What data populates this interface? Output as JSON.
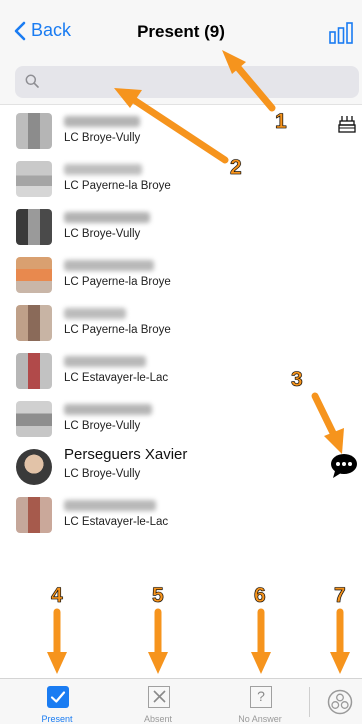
{
  "nav": {
    "back_label": "Back",
    "title": "Present (9)",
    "chart_icon": "bar-chart-icon"
  },
  "search": {
    "placeholder": "",
    "icon": "search-icon"
  },
  "members": [
    {
      "name": "",
      "club": "LC Broye-Vully",
      "birthday": true
    },
    {
      "name": "",
      "club": "LC Payerne-la Broye"
    },
    {
      "name": "",
      "club": "LC Broye-Vully"
    },
    {
      "name": "",
      "club": "LC Payerne-la Broye"
    },
    {
      "name": "",
      "club": "LC Payerne-la Broye"
    },
    {
      "name": "",
      "club": "LC Estavayer-le-Lac"
    },
    {
      "name": "",
      "club": "LC Broye-Vully"
    },
    {
      "name": "Perseguers Xavier",
      "club": "LC Broye-Vully",
      "message": true
    },
    {
      "name": "",
      "club": "LC Estavayer-le-Lac"
    }
  ],
  "annotations": [
    "1",
    "2",
    "3",
    "4",
    "5",
    "6",
    "7"
  ],
  "tabs": [
    {
      "label": "Present",
      "icon": "checkbox-checked-icon",
      "active": true
    },
    {
      "label": "Absent",
      "icon": "checkbox-x-icon"
    },
    {
      "label": "No Answer",
      "icon": "checkbox-question-icon",
      "glyph": "?"
    },
    {
      "label": "",
      "icon": "groups-circle-icon"
    }
  ],
  "colors": {
    "accent": "#1a7cf2",
    "annotation": "#f6941d"
  }
}
